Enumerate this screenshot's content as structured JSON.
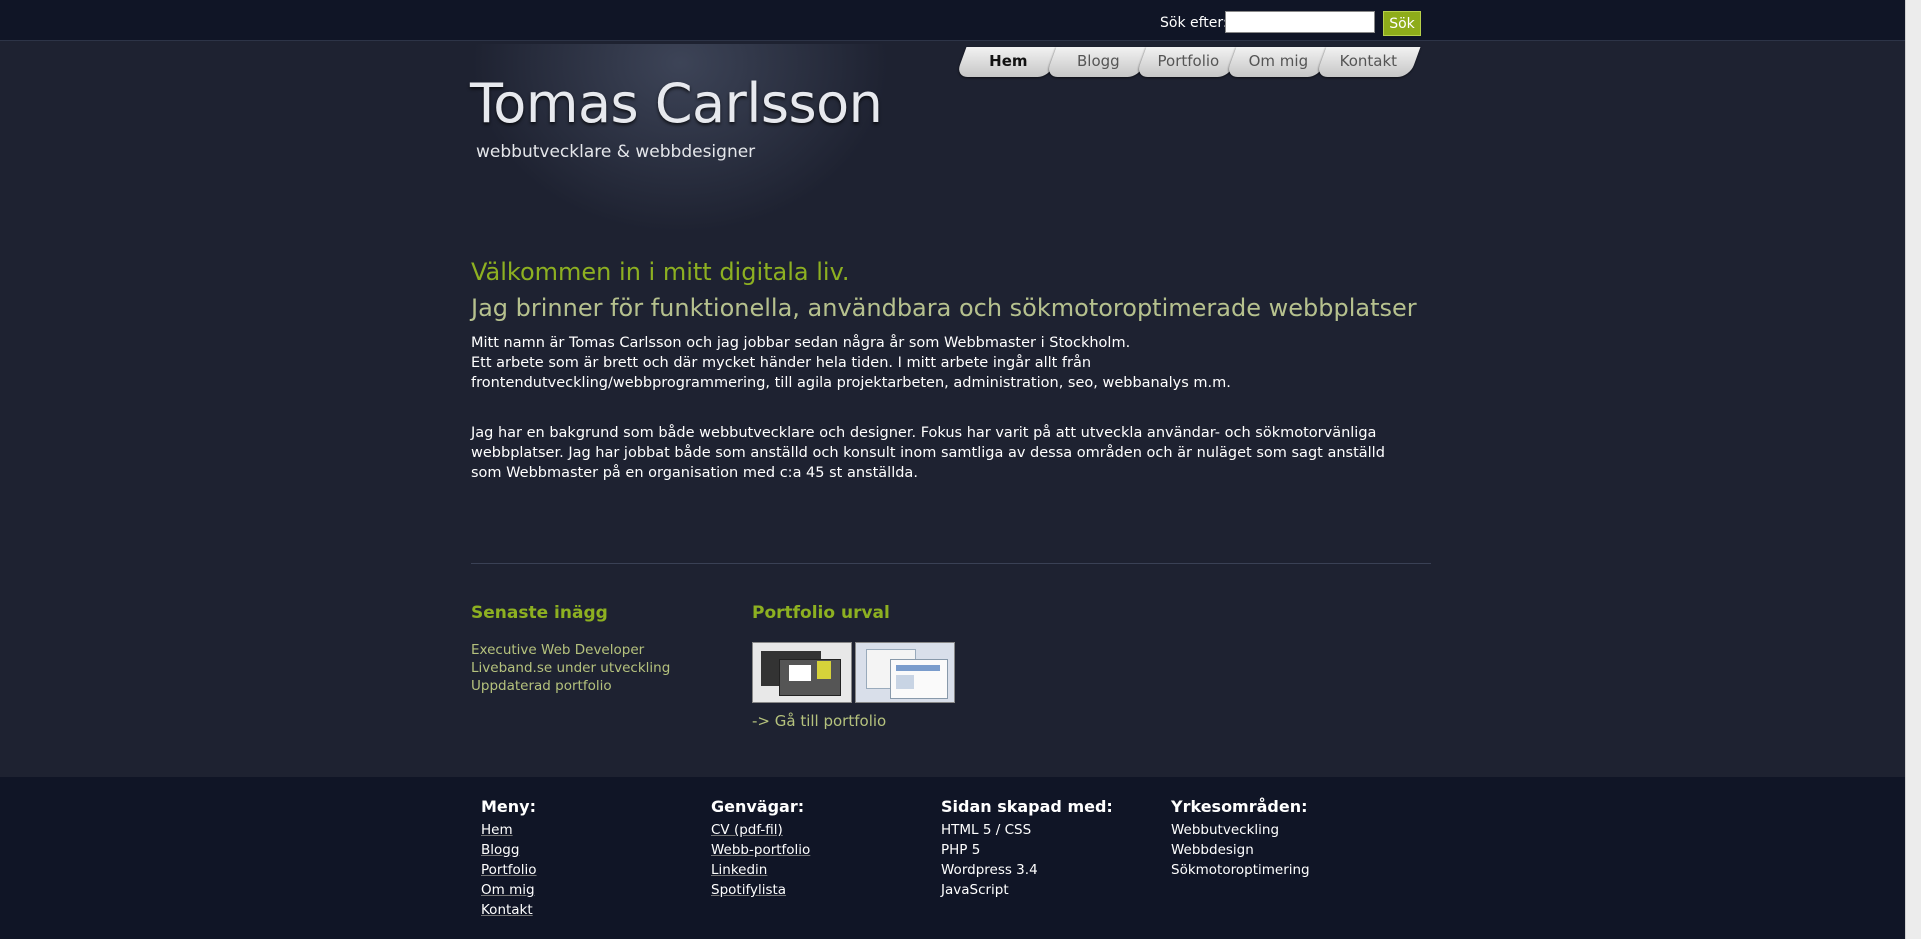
{
  "search": {
    "label": "Sök efter:",
    "button": "Sök",
    "value": ""
  },
  "site": {
    "title": "Tomas Carlsson",
    "subtitle": "webbutvecklare & webbdesigner"
  },
  "nav": {
    "items": [
      "Hem",
      "Blogg",
      "Portfolio",
      "Om mig",
      "Kontakt"
    ],
    "active": "Hem"
  },
  "main": {
    "welcome": "Välkommen in i mitt digitala liv.",
    "tagline": "Jag brinner för funktionella, användbara och sökmotoroptimerade webbplatser",
    "intro_line1": "Mitt namn är Tomas Carlsson och jag jobbar sedan några år som Webbmaster i Stockholm.",
    "intro_line2": "Ett arbete som är brett och där mycket händer hela tiden. I mitt arbete ingår allt från frontendutveckling/webbprogrammering, till agila projektarbeten, administration, seo, webbanalys m.m.",
    "background": "Jag har en bakgrund som både webbutvecklare och designer. Fokus har varit på att utveckla användar- och sökmotorvänliga webbplatser. Jag har jobbat både som anställd och konsult inom samtliga av dessa områden och är nuläget som sagt anställd som Webbmaster på en organisation med c:a 45 st anställda."
  },
  "latest": {
    "heading": "Senaste inägg",
    "posts": [
      "Executive Web Developer",
      "Liveband.se under utveckling",
      "Uppdaterad portfolio"
    ]
  },
  "portfolio": {
    "heading": "Portfolio urval",
    "link": "-> Gå till portfolio"
  },
  "footer": {
    "menu": {
      "heading": "Meny:",
      "items": [
        "Hem",
        "Blogg",
        "Portfolio",
        "Om mig",
        "Kontakt"
      ]
    },
    "shortcuts": {
      "heading": "Genvägar:",
      "items": [
        "CV (pdf-fil)",
        "Webb-portfolio",
        "Linkedin",
        "Spotifylista"
      ]
    },
    "built": {
      "heading": "Sidan skapad med:",
      "items": [
        "HTML 5 / CSS",
        "PHP 5",
        "Wordpress 3.4",
        "JavaScript"
      ]
    },
    "areas": {
      "heading": "Yrkesområden:",
      "items": [
        "Webbutveckling",
        "Webbdesign",
        "Sökmotoroptimering"
      ]
    }
  },
  "colors": {
    "accent": "#8db021",
    "background": "#1e2231",
    "topbar": "#101526"
  }
}
